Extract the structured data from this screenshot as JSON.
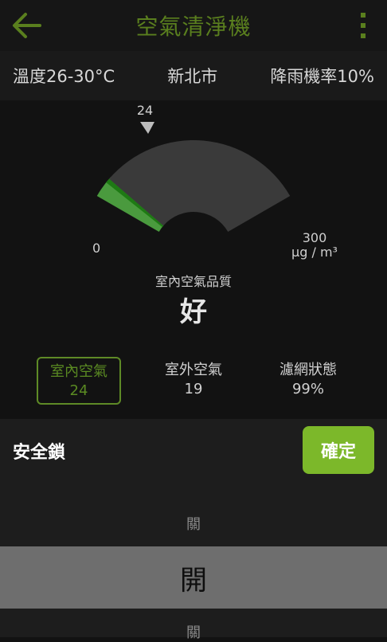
{
  "header": {
    "title": "空氣清淨機",
    "accent_color": "#5a7f1e",
    "back_icon": "arrow-left-icon",
    "menu_icon": "more-vertical-icon"
  },
  "info": {
    "temperature": "溫度26-30°C",
    "city": "新北市",
    "rain": "降雨機率10%"
  },
  "gauge": {
    "value": 24,
    "value_label": "24",
    "min_label": "0",
    "max_label": "300",
    "unit": "μg / m³",
    "caption": "室內空氣品質",
    "status": "好",
    "min": 0,
    "max": 300
  },
  "stats": [
    {
      "label": "室內空氣",
      "value": "24"
    },
    {
      "label": "室外空氣",
      "value": "19"
    },
    {
      "label": "濾網狀態",
      "value": "99%"
    }
  ],
  "sheet": {
    "lock_label": "安全鎖",
    "confirm_label": "確定",
    "confirm_color": "#7cb82a",
    "options_above": "關",
    "selected": "開",
    "options_below": "關"
  }
}
